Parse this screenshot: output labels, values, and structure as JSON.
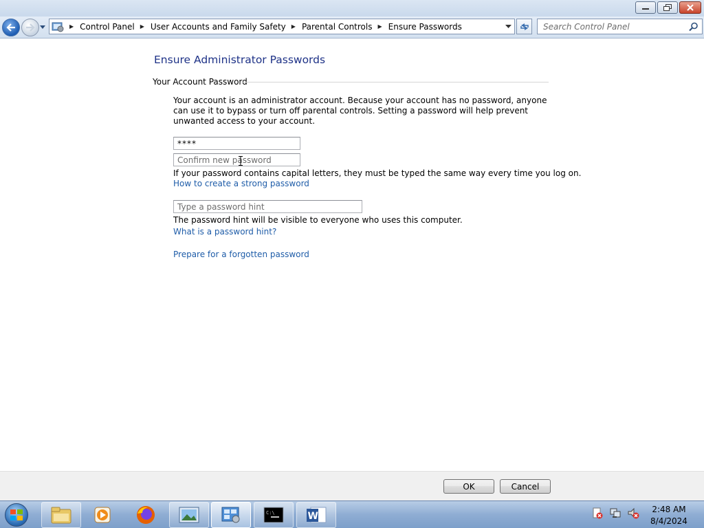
{
  "window": {
    "minimize_icon": "minimize-icon",
    "maximize_icon": "restore-icon",
    "close_icon": "close-icon"
  },
  "nav": {
    "breadcrumbs": [
      "Control Panel",
      "User Accounts and Family Safety",
      "Parental Controls",
      "Ensure Passwords"
    ],
    "search_placeholder": "Search Control Panel"
  },
  "page": {
    "title": "Ensure Administrator Passwords",
    "section_heading": "Your Account Password",
    "description": "Your account is an administrator account. Because your account has no password, anyone can use it to bypass or turn off parental controls. Setting a password will help prevent unwanted access to your account.",
    "new_password_value": "****",
    "confirm_placeholder": "Confirm new password",
    "capital_letters_note": "If your password contains capital letters, they must be typed the same way every time you log on.",
    "strong_password_link": "How to create a strong password",
    "hint_placeholder": "Type a password hint",
    "hint_note": "The password hint will be visible to everyone who uses this computer.",
    "hint_link": "What is a password hint?",
    "forgotten_link": "Prepare for a forgotten password"
  },
  "buttons": {
    "ok": "OK",
    "cancel": "Cancel"
  },
  "taskbar": {
    "items": [
      "windows-explorer",
      "media-player",
      "firefox",
      "photo-viewer",
      "control-panel",
      "command-prompt",
      "microsoft-word"
    ],
    "time": "2:48 AM",
    "date": "8/4/2024"
  },
  "colors": {
    "title_blue": "#1e3287",
    "link_blue": "#1e5ca8",
    "taskbar": "#8fadd3"
  }
}
